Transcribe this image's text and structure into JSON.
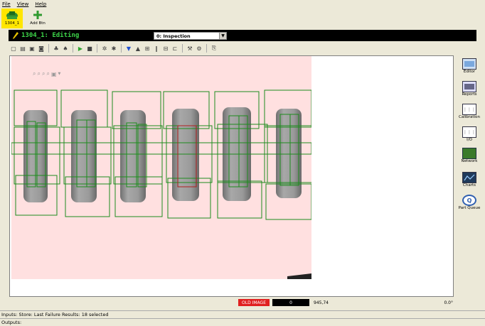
{
  "menu": {
    "file": "File",
    "view": "View",
    "help": "Help"
  },
  "topbar": {
    "camera_label": "1304_1",
    "add_label": "Add Btn"
  },
  "editor": {
    "title": "1304_1: Editing",
    "inspection_select": "0: Inspection"
  },
  "rightpanel": {
    "editor": "Editor",
    "reports": "Reports",
    "calibration": "Calibration",
    "io": "I/O",
    "network": "Network",
    "charts": "Charts",
    "part_queue": "Part Queue"
  },
  "status": {
    "old_image": "OLD IMAGE",
    "value": "0",
    "coords": "945,74",
    "angle": "0.0°"
  },
  "bottom": {
    "inputs": "Inputs: Store: Last Failure  Results: 18 selected",
    "outputs": "Outputs:"
  },
  "colors": {
    "editing_text": "#3ed64a",
    "roi_pass": "#1e8c1e",
    "roi_fail": "#b02020",
    "old_image_bg": "#e02020"
  }
}
